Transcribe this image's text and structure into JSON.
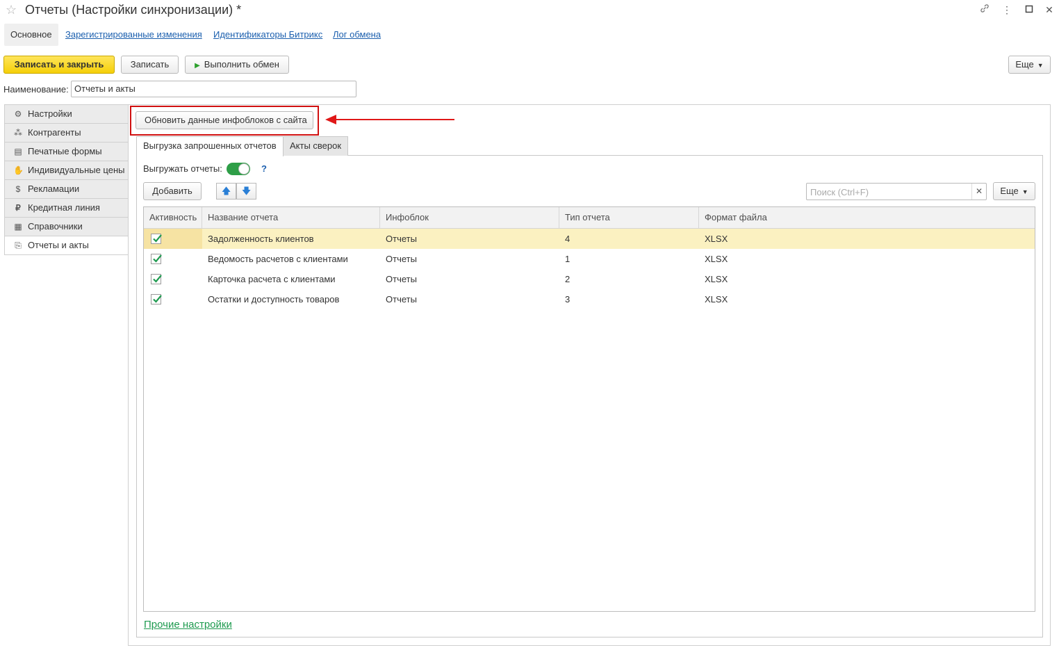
{
  "window": {
    "title": "Отчеты (Настройки синхронизации) *",
    "icons": [
      "star-icon",
      "link-icon",
      "more-vertical-icon",
      "maximize-icon",
      "close-icon"
    ]
  },
  "nav": {
    "active_tab": "Основное",
    "links": [
      "Зарегистрированные изменения",
      "Идентификаторы Битрикс",
      "Лог обмена"
    ]
  },
  "toolbar": {
    "save_close": "Записать и закрыть",
    "save": "Записать",
    "run_exchange": "Выполнить обмен",
    "more": "Еще"
  },
  "form": {
    "name_label": "Наименование:",
    "name_value": "Отчеты и акты"
  },
  "sidebar": {
    "items": [
      {
        "label": "Настройки",
        "icon": "gear-icon"
      },
      {
        "label": "Контрагенты",
        "icon": "users-icon"
      },
      {
        "label": "Печатные формы",
        "icon": "document-icon"
      },
      {
        "label": "Индивидуальные цены",
        "icon": "handshake-icon"
      },
      {
        "label": "Рекламации",
        "icon": "money-bag-icon"
      },
      {
        "label": "Кредитная линия",
        "icon": "ruble-icon"
      },
      {
        "label": "Справочники",
        "icon": "table-icon"
      },
      {
        "label": "Отчеты и акты",
        "icon": "report-icon"
      }
    ],
    "active_index": 7
  },
  "main": {
    "update_button": "Обновить данные инфоблоков с сайта",
    "tabs": [
      "Выгрузка запрошенных отчетов",
      "Акты сверок"
    ],
    "export_label": "Выгружать отчеты:",
    "export_enabled": true,
    "help": "?",
    "add_button": "Добавить",
    "search_placeholder": "Поиск (Ctrl+F)",
    "more": "Еще",
    "footer_link": "Прочие настройки"
  },
  "table": {
    "columns": [
      "Активность",
      "Название отчета",
      "Инфоблок",
      "Тип отчета",
      "Формат файла"
    ],
    "rows": [
      {
        "active": true,
        "name": "Задолженность клиентов",
        "infoblock": "Отчеты",
        "type": "4",
        "format": "XLSX",
        "selected": true
      },
      {
        "active": true,
        "name": "Ведомость расчетов с клиентами",
        "infoblock": "Отчеты",
        "type": "1",
        "format": "XLSX",
        "selected": false
      },
      {
        "active": true,
        "name": "Карточка расчета с клиентами",
        "infoblock": "Отчеты",
        "type": "2",
        "format": "XLSX",
        "selected": false
      },
      {
        "active": true,
        "name": "Остатки и доступность товаров",
        "infoblock": "Отчеты",
        "type": "3",
        "format": "XLSX",
        "selected": false
      }
    ]
  },
  "colors": {
    "primary_button": "#f5cf08",
    "link": "#1b5fae",
    "footer_link": "#1e9a4f",
    "highlight_box": "#d01010",
    "selected_row": "#fbf1c1",
    "toggle_on": "#2e9e47",
    "check": "#1e9a4f"
  }
}
